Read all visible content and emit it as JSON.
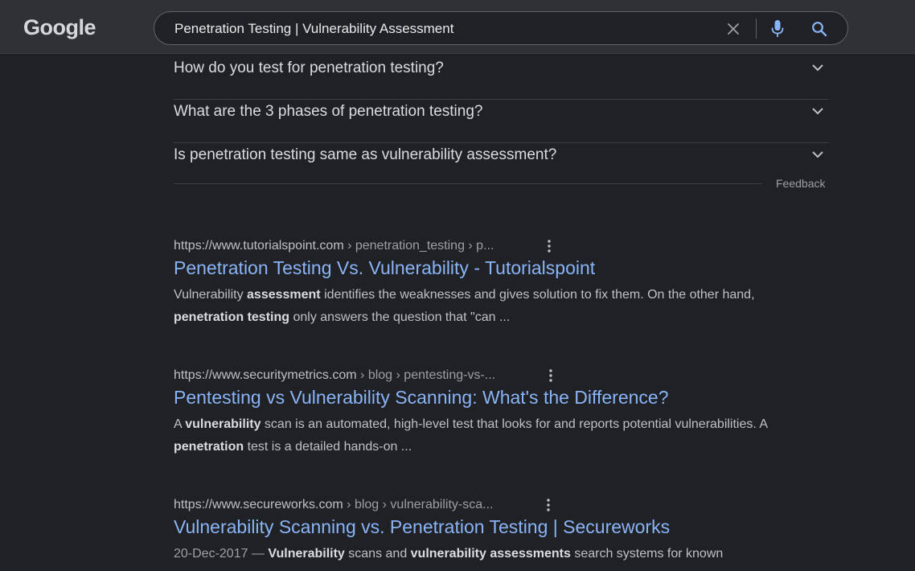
{
  "header": {
    "logo_text": "Google",
    "search": {
      "value": "Penetration Testing | Vulnerability Assessment",
      "placeholder": ""
    },
    "icons": {
      "clear": "close-icon",
      "mic": "microphone-icon",
      "search": "search-icon"
    }
  },
  "people_also_ask": {
    "items": [
      {
        "question": "How do you test for penetration testing?"
      },
      {
        "question": "What are the 3 phases of penetration testing?"
      },
      {
        "question": "Is penetration testing same as vulnerability assessment?"
      }
    ],
    "feedback_label": "Feedback"
  },
  "results": [
    {
      "domain": "https://www.tutorialspoint.com",
      "path": " › penetration_testing › p...",
      "title": "Penetration Testing Vs. Vulnerability - Tutorialspoint",
      "snippet": [
        {
          "t": "Vulnerability "
        },
        {
          "t": "assessment",
          "b": true
        },
        {
          "t": " identifies the weaknesses and gives solution to fix them. On the other hand, "
        },
        {
          "t": "penetration testing",
          "b": true
        },
        {
          "t": " only answers the question that \"can ..."
        }
      ]
    },
    {
      "domain": "https://www.securitymetrics.com",
      "path": " › blog › pentesting-vs-...",
      "title": "Pentesting vs Vulnerability Scanning: What's the Difference?",
      "snippet": [
        {
          "t": "A "
        },
        {
          "t": "vulnerability",
          "b": true
        },
        {
          "t": " scan is an automated, high-level test that looks for and reports potential vulnerabilities. A "
        },
        {
          "t": "penetration",
          "b": true
        },
        {
          "t": " test is a detailed hands-on ..."
        }
      ]
    },
    {
      "domain": "https://www.secureworks.com",
      "path": " › blog › vulnerability-sca...",
      "title": "Vulnerability Scanning vs. Penetration Testing | Secureworks",
      "snippet": [
        {
          "t": "20-Dec-2017 — ",
          "date": true
        },
        {
          "t": "Vulnerability",
          "b": true
        },
        {
          "t": " scans and "
        },
        {
          "t": "vulnerability assessments",
          "b": true
        },
        {
          "t": " search systems for known"
        }
      ]
    }
  ],
  "colors": {
    "background": "#202124",
    "header": "#303134",
    "link": "#8ab4f8",
    "text": "#bdc1c6"
  }
}
